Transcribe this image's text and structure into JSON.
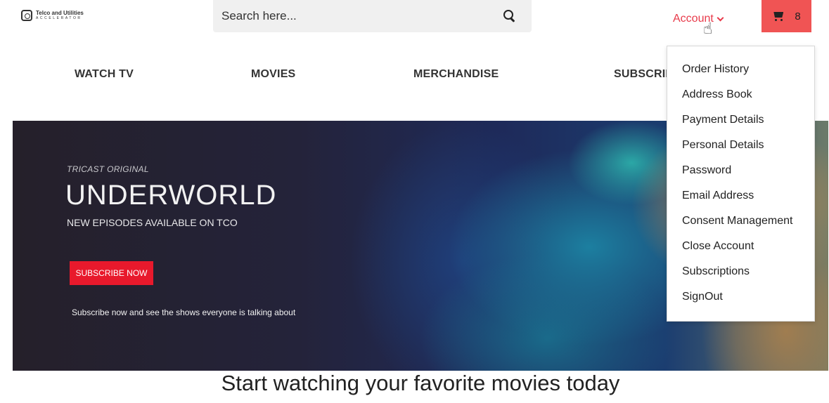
{
  "brand": {
    "line1": "Telco and Utilities",
    "line2": "ACCELERATOR"
  },
  "search": {
    "placeholder": "Search here..."
  },
  "account": {
    "label": "Account"
  },
  "cart": {
    "count": "8"
  },
  "nav": [
    "WATCH TV",
    "MOVIES",
    "MERCHANDISE",
    "SUBSCRIP"
  ],
  "hero": {
    "kicker": "TRICAST ORIGINAL",
    "title": "UNDERWORLD",
    "subtitle": "NEW EPISODES AVAILABLE ON TCO",
    "button": "SUBSCRIBE NOW",
    "note": "Subscribe now and see the shows everyone is talking about"
  },
  "tagline": "Start watching your favorite movies today",
  "account_menu": [
    "Order History",
    "Address Book",
    "Payment Details",
    "Personal Details",
    "Password",
    "Email Address",
    "Consent Management",
    "Close Account",
    "Subscriptions",
    "SignOut"
  ],
  "colors": {
    "accent": "#e83a4a",
    "cart_bg": "#f05454",
    "cta": "#e8192c"
  },
  "icons": {
    "search": "search-icon",
    "cart": "cart-icon",
    "chevron": "chevron-down-icon",
    "cursor": "hand-cursor-icon"
  }
}
